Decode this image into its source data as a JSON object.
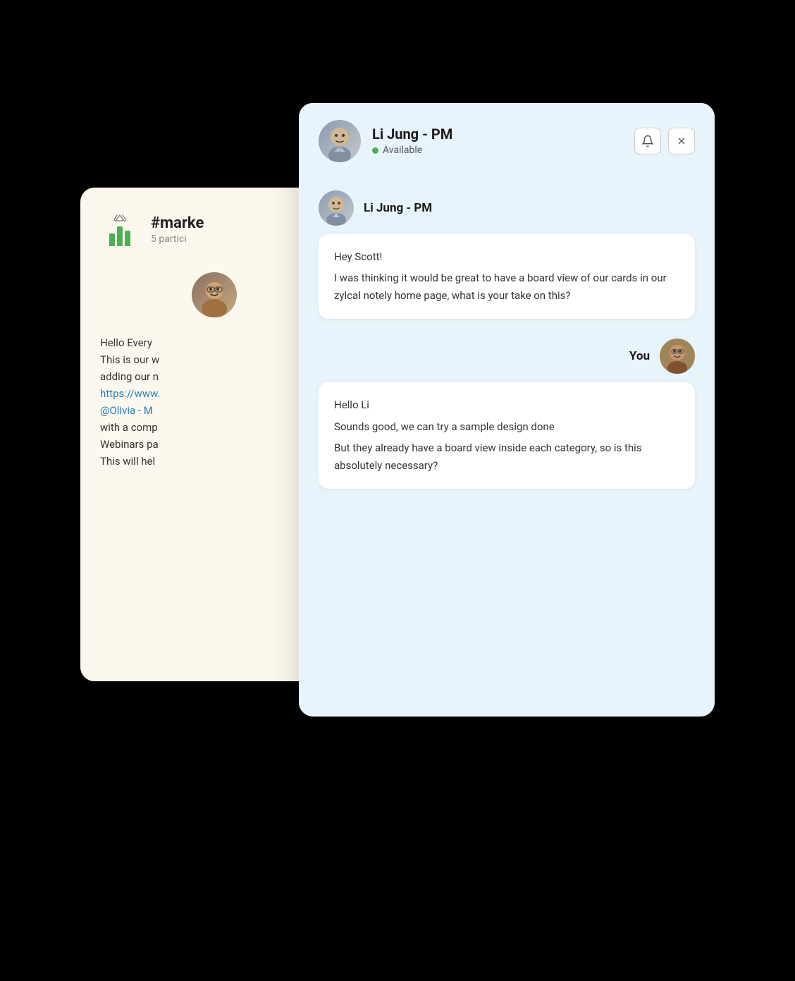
{
  "channel_card": {
    "icon_label": "bar-chart-icon",
    "channel_name": "#marke",
    "participants": "5 partici",
    "message_lines": [
      "Hello Every",
      "This is our w",
      "adding our n",
      "https://www.",
      "@Olivia - M",
      "with a comp",
      "Webinars pa",
      "This will hel"
    ]
  },
  "chat_card": {
    "header": {
      "name": "Li Jung - PM",
      "status": "Available",
      "bell_label": "🔔",
      "close_label": "✕"
    },
    "messages": [
      {
        "sender": "Li Jung - PM",
        "type": "received",
        "lines": [
          "Hey Scott!",
          "I was thinking it would be great to have a board view of our cards in our zylcal notely home page, what is your take on this?"
        ]
      },
      {
        "sender": "You",
        "type": "sent",
        "lines": [
          "Hello Li",
          "Sounds good, we can try a sample design done",
          "But they already have a board view inside each category, so is this absolutely necessary?"
        ]
      }
    ]
  }
}
